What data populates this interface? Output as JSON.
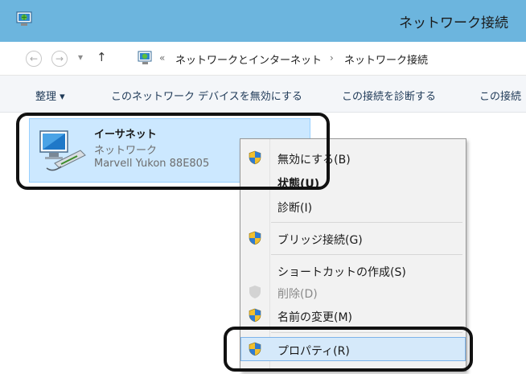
{
  "window": {
    "title": "ネットワーク接続",
    "icon": "network-connections-icon"
  },
  "address": {
    "back_icon": "back-arrow-icon",
    "forward_icon": "forward-arrow-icon",
    "recent_icon": "chevron-down-icon",
    "up_icon": "up-arrow-icon",
    "overflow": "«",
    "crumbs": [
      "ネットワークとインターネット",
      "ネットワーク接続"
    ],
    "separator": "›"
  },
  "commands": {
    "organize": "整理 ▾",
    "disable": "このネットワーク デバイスを無効にする",
    "diagnose": "この接続を診断する",
    "more": "この接続"
  },
  "adapter": {
    "name": "イーサネット",
    "status": "ネットワーク",
    "device": "Marvell Yukon 88E805"
  },
  "context_menu": {
    "items": [
      {
        "label": "無効にする(B)",
        "shield": true,
        "bold": false,
        "disabled": false
      },
      {
        "label": "状態(U)",
        "shield": false,
        "bold": true,
        "disabled": false
      },
      {
        "label": "診断(I)",
        "shield": false,
        "bold": false,
        "disabled": false
      },
      {
        "label": "ブリッジ接続(G)",
        "shield": true,
        "bold": false,
        "disabled": false
      },
      {
        "label": "ショートカットの作成(S)",
        "shield": false,
        "bold": false,
        "disabled": false
      },
      {
        "label": "削除(D)",
        "shield": true,
        "bold": false,
        "disabled": true
      },
      {
        "label": "名前の変更(M)",
        "shield": true,
        "bold": false,
        "disabled": false
      },
      {
        "label": "プロパティ(R)",
        "shield": true,
        "bold": false,
        "disabled": false,
        "hover": true
      }
    ]
  },
  "colors": {
    "titlebar": "#6cb5de",
    "selection": "#cce8ff",
    "frame": "#111111"
  }
}
